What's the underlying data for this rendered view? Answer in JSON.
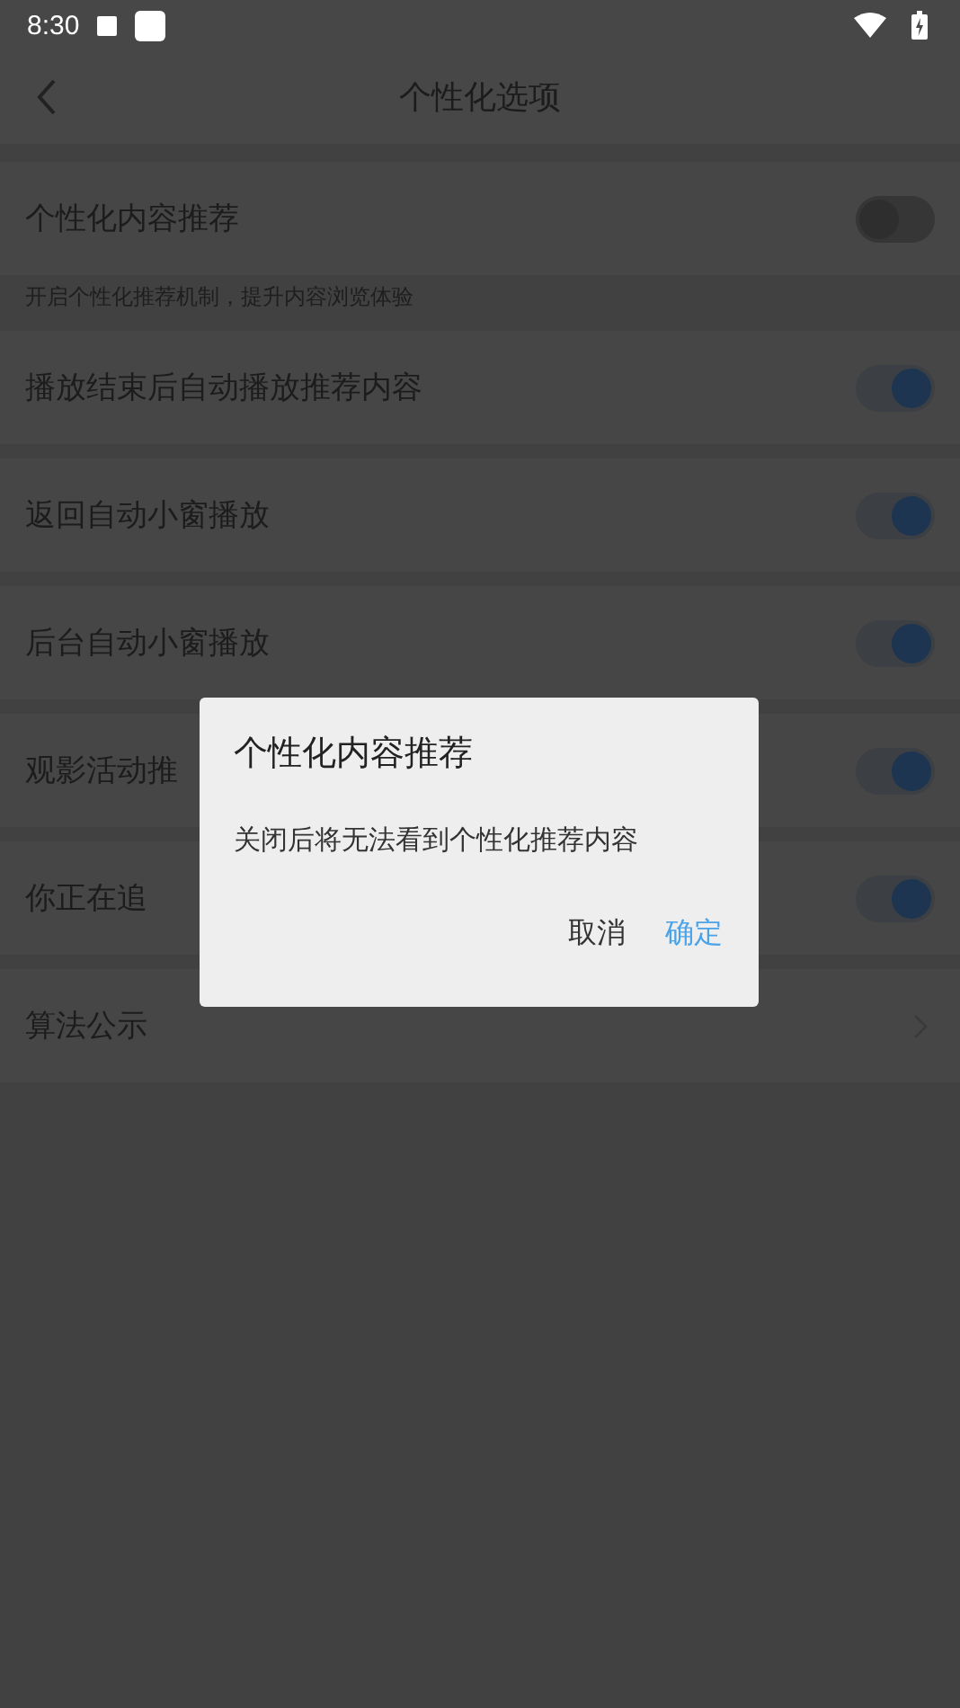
{
  "status_bar": {
    "time": "8:30"
  },
  "header": {
    "title": "个性化选项"
  },
  "settings": [
    {
      "kind": "toggle",
      "label": "个性化内容推荐",
      "on": false,
      "caption": "开启个性化推荐机制，提升内容浏览体验"
    },
    {
      "kind": "toggle",
      "label": "播放结束后自动播放推荐内容",
      "on": true
    },
    {
      "kind": "toggle",
      "label": "返回自动小窗播放",
      "on": true
    },
    {
      "kind": "toggle",
      "label": "后台自动小窗播放",
      "on": true
    },
    {
      "kind": "toggle",
      "label": "观影活动推",
      "on": true
    },
    {
      "kind": "toggle",
      "label": "你正在追",
      "on": true
    },
    {
      "kind": "link",
      "label": "算法公示"
    }
  ],
  "dialog": {
    "title": "个性化内容推荐",
    "message": "关闭后将无法看到个性化推荐内容",
    "buttons": [
      {
        "label": "取消",
        "primary": false
      },
      {
        "label": "确定",
        "primary": true
      }
    ]
  }
}
